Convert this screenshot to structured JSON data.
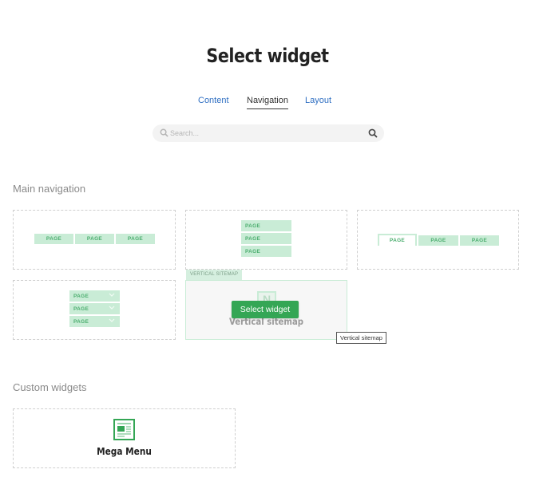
{
  "header": {
    "title": "Select widget"
  },
  "tabs": [
    {
      "label": "Content",
      "active": false
    },
    {
      "label": "Navigation",
      "active": true
    },
    {
      "label": "Layout",
      "active": false
    }
  ],
  "search": {
    "placeholder": "Search...",
    "value": ""
  },
  "sections": {
    "main_navigation": {
      "title": "Main navigation",
      "widgets": [
        {
          "type": "horizontal",
          "items": [
            "PAGE",
            "PAGE",
            "PAGE"
          ]
        },
        {
          "type": "vertical",
          "items": [
            "PAGE",
            "PAGE",
            "PAGE"
          ]
        },
        {
          "type": "tabs",
          "items": [
            "PAGE",
            "PAGE",
            "PAGE"
          ]
        },
        {
          "type": "vertical-dropdown",
          "items": [
            "PAGE",
            "PAGE",
            "PAGE"
          ]
        },
        {
          "type": "vertical-sitemap",
          "name": "Vertical sitemap",
          "hover_label": "VERTICAL SITEMAP",
          "icon_letter": "N",
          "hovered": true
        }
      ]
    },
    "custom_widgets": {
      "title": "Custom widgets",
      "widgets": [
        {
          "name": "Mega Menu",
          "icon": "mega-menu-icon"
        }
      ]
    }
  },
  "select_button": {
    "label": "Select widget"
  },
  "tooltip": {
    "text": "Vertical sitemap"
  },
  "colors": {
    "accent_green": "#34a655",
    "page_bg_green": "#c9ecd6",
    "page_text_green": "#4cae6f",
    "link_blue": "#2f6fc2"
  }
}
